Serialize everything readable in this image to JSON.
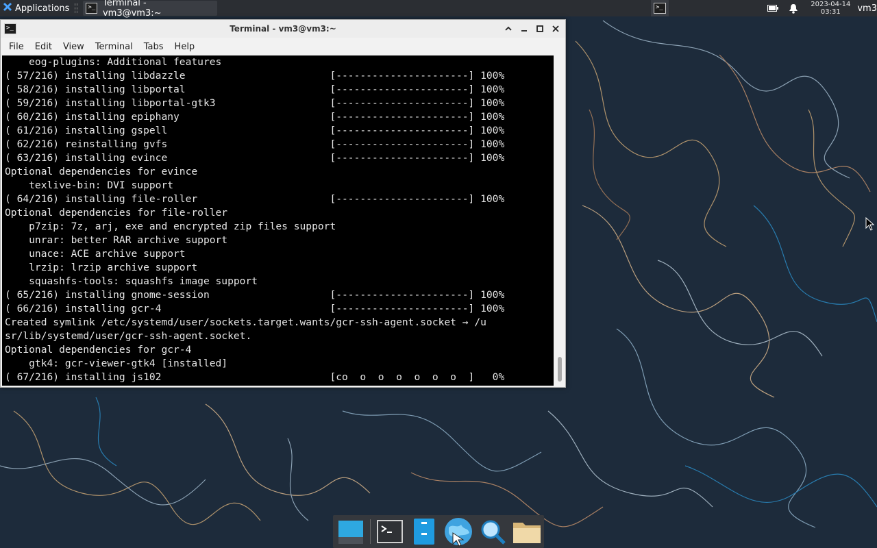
{
  "top_panel": {
    "applications_label": "Applications",
    "task_title": "Terminal - vm3@vm3:~",
    "date": "2023-04-14",
    "time": "03:31",
    "user": "vm3"
  },
  "window": {
    "title": "Terminal - vm3@vm3:~",
    "menu": [
      "File",
      "Edit",
      "View",
      "Terminal",
      "Tabs",
      "Help"
    ]
  },
  "terminal": {
    "lines": [
      "    eog-plugins: Additional features",
      "( 57/216) installing libdazzle                        [----------------------] 100%",
      "( 58/216) installing libportal                        [----------------------] 100%",
      "( 59/216) installing libportal-gtk3                   [----------------------] 100%",
      "( 60/216) installing epiphany                         [----------------------] 100%",
      "( 61/216) installing gspell                           [----------------------] 100%",
      "( 62/216) reinstalling gvfs                           [----------------------] 100%",
      "( 63/216) installing evince                           [----------------------] 100%",
      "Optional dependencies for evince",
      "    texlive-bin: DVI support",
      "( 64/216) installing file-roller                      [----------------------] 100%",
      "Optional dependencies for file-roller",
      "    p7zip: 7z, arj, exe and encrypted zip files support",
      "    unrar: better RAR archive support",
      "    unace: ACE archive support",
      "    lrzip: lrzip archive support",
      "    squashfs-tools: squashfs image support",
      "( 65/216) installing gnome-session                    [----------------------] 100%",
      "( 66/216) installing gcr-4                            [----------------------] 100%",
      "Created symlink /etc/systemd/user/sockets.target.wants/gcr-ssh-agent.socket → /u",
      "sr/lib/systemd/user/gcr-ssh-agent.socket.",
      "Optional dependencies for gcr-4",
      "    gtk4: gcr-viewer-gtk4 [installed]",
      "( 67/216) installing js102                            [co  o  o  o  o  o  o  ]   0%"
    ]
  },
  "dock": {
    "items": [
      "desktop-icon",
      "terminal-icon",
      "file-manager-icon",
      "web-browser-icon",
      "app-finder-icon",
      "folder-icon"
    ]
  }
}
